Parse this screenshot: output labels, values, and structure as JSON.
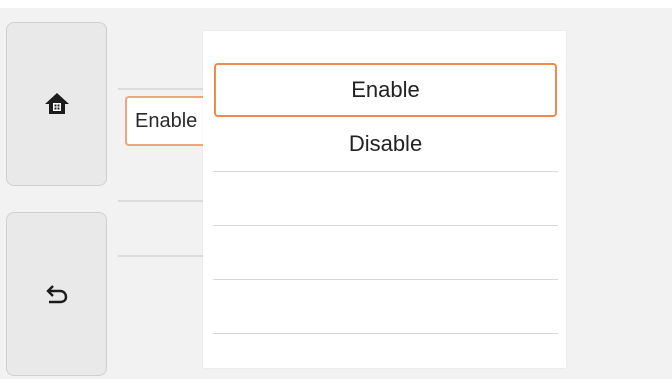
{
  "sidebar": {
    "home_icon": "home-icon",
    "back_icon": "back-arrow-icon"
  },
  "background": {
    "field_text": "Enable"
  },
  "popup": {
    "options": [
      {
        "label": "Enable",
        "selected": true
      },
      {
        "label": "Disable",
        "selected": false
      },
      {
        "label": ""
      },
      {
        "label": ""
      },
      {
        "label": ""
      }
    ]
  },
  "colors": {
    "accent": "#ee8a4f",
    "background": "#f2f2f2",
    "button": "#e9e9e9"
  }
}
